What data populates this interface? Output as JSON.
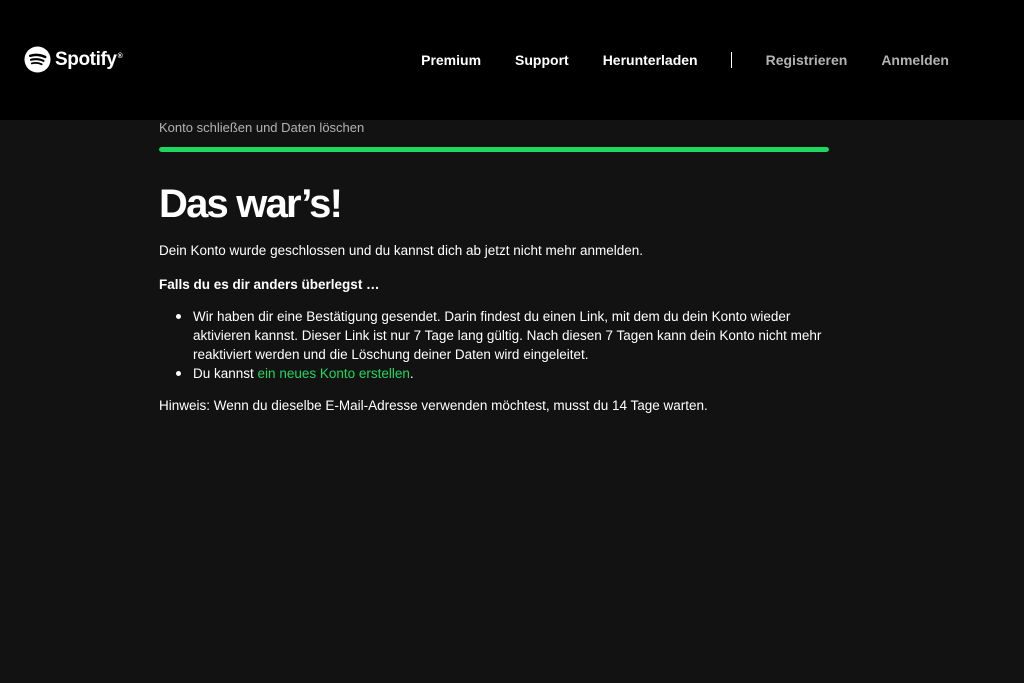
{
  "header": {
    "logo_text": "Spotify",
    "logo_reg": "®",
    "logo_icon": "spotify-logo-icon",
    "nav_primary": [
      "Premium",
      "Support",
      "Herunterladen"
    ],
    "nav_secondary": [
      "Registrieren",
      "Anmelden"
    ]
  },
  "main": {
    "breadcrumb": "Konto schließen und Daten löschen",
    "progress_fraction": 1.0,
    "headline": "Das war’s!",
    "intro": "Dein Konto wurde geschlossen und du kannst dich ab jetzt nicht mehr anmelden.",
    "subhead": "Falls du es dir anders überlegst …",
    "bullet1": "Wir haben dir eine Bestätigung gesendet. Darin findest du einen Link, mit dem du dein Konto wieder aktivieren kannst. Dieser Link ist nur 7 Tage lang gültig. Nach diesen 7 Tagen kann dein Konto nicht mehr reaktiviert werden und die Löschung deiner Daten wird eingeleitet.",
    "bullet2_prefix": "Du kannst ",
    "bullet2_link": "ein neues Konto erstellen",
    "bullet2_suffix": ".",
    "hint": "Hinweis: Wenn du dieselbe E-Mail-Adresse verwenden möchtest, musst du 14 Tage warten."
  },
  "colors": {
    "background": "#121212",
    "header_background": "#000000",
    "accent": "#1ed760",
    "muted_text": "#b3b3b3"
  }
}
